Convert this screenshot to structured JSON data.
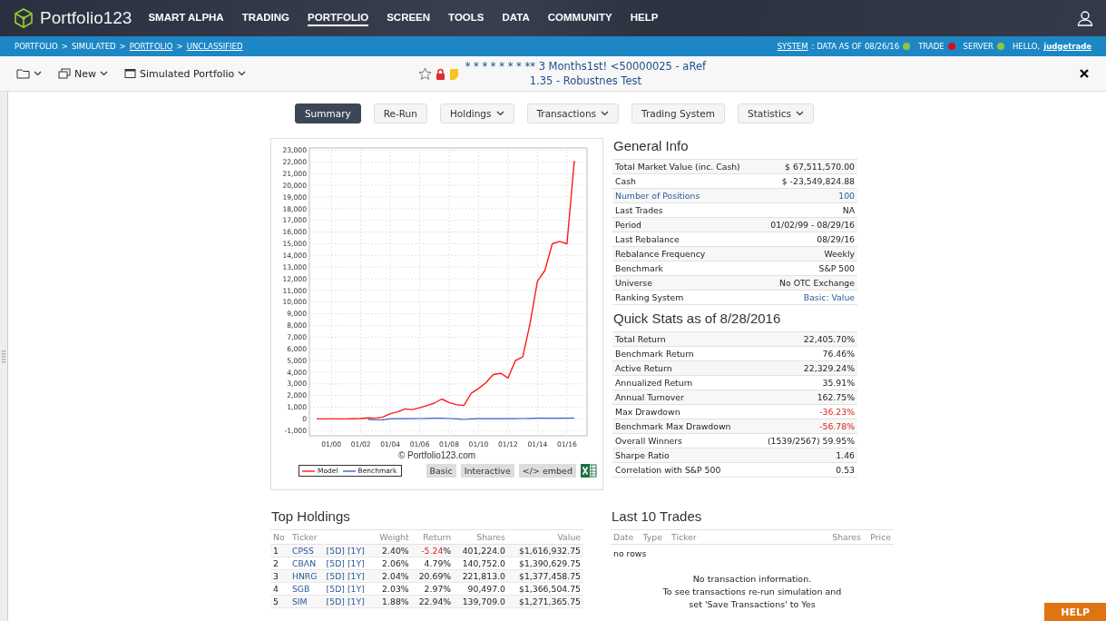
{
  "nav": {
    "brand": "Portfolio123",
    "items": [
      {
        "label": "SMART ALPHA",
        "selected": false
      },
      {
        "label": "TRADING",
        "selected": false
      },
      {
        "label": "PORTFOLIO",
        "selected": true
      },
      {
        "label": "SCREEN",
        "selected": false
      },
      {
        "label": "TOOLS",
        "selected": false
      },
      {
        "label": "DATA",
        "selected": false
      },
      {
        "label": "COMMUNITY",
        "selected": false
      },
      {
        "label": "HELP",
        "selected": false
      }
    ]
  },
  "breadcrumb": {
    "crumbs": [
      {
        "label": "PORTFOLIO",
        "link": false
      },
      {
        "label": "SIMULATED",
        "link": false
      },
      {
        "label": "PORTFOLIO",
        "link": true
      },
      {
        "label": "UNCLASSIFIED",
        "link": true
      }
    ],
    "separators": [
      ">",
      ">",
      ">"
    ],
    "system_link": "SYSTEM",
    "indicators": [
      {
        "label": ": DATA AS OF 08/26/16",
        "color": "#8cc63f"
      },
      {
        "label": "TRADE",
        "color": "#d0101b"
      },
      {
        "label": "SERVER",
        "color": "#8cc63f"
      }
    ],
    "greeting": "HELLO,",
    "user": "judgetrade"
  },
  "toolbar": {
    "new_label": "New",
    "portfolio_type": "Simulated Portfolio",
    "title": "* * * * * * * ** 3 Months1st! <50000025 - aRef 1.35 - Robustnes Test"
  },
  "tabs": [
    {
      "label": "Summary",
      "selected": true,
      "dropdown": false
    },
    {
      "label": "Re-Run",
      "selected": false,
      "dropdown": false
    },
    {
      "label": "Holdings",
      "selected": false,
      "dropdown": true
    },
    {
      "label": "Transactions",
      "selected": false,
      "dropdown": true
    },
    {
      "label": "Trading System",
      "selected": false,
      "dropdown": false
    },
    {
      "label": "Statistics",
      "selected": false,
      "dropdown": true
    }
  ],
  "chart": {
    "copyright": "© Portfolio123.com",
    "buttons": [
      "Basic",
      "Interactive",
      "</> embed"
    ],
    "chart_data": {
      "type": "line",
      "categories": [
        null,
        null,
        "01/00",
        null,
        null,
        null,
        "01/02",
        null,
        null,
        null,
        "01/04",
        null,
        null,
        null,
        "01/06",
        null,
        null,
        null,
        "01/08",
        null,
        null,
        null,
        "01/10",
        null,
        null,
        null,
        "01/12",
        null,
        null,
        null,
        "01/14",
        null,
        null,
        null,
        "01/16",
        null
      ],
      "series": [
        {
          "name": "Model",
          "color": "#ff1a1a",
          "values": [
            0,
            0,
            0,
            0,
            0,
            10,
            30,
            80,
            60,
            150,
            450,
            600,
            850,
            800,
            950,
            1150,
            1350,
            1700,
            1400,
            1200,
            1150,
            2200,
            2600,
            3100,
            3800,
            3900,
            3500,
            5000,
            5300,
            8200,
            11800,
            12700,
            15000,
            15200,
            15000,
            22100
          ]
        },
        {
          "name": "Benchmark",
          "color": "#3a5fd0",
          "values": [
            null,
            null,
            null,
            null,
            null,
            null,
            null,
            -60,
            -90,
            -70,
            0,
            10,
            20,
            20,
            30,
            40,
            50,
            50,
            30,
            0,
            -50,
            0,
            10,
            20,
            20,
            10,
            20,
            20,
            30,
            40,
            50,
            60,
            70,
            60,
            60,
            80
          ]
        }
      ],
      "ylim": [
        -1450,
        23200
      ],
      "grid": true,
      "yticks": [
        {
          "value": -1000,
          "label": "-1,000"
        },
        {
          "value": 0,
          "label": "0"
        },
        {
          "value": 1000,
          "label": "1,000"
        },
        {
          "value": 2000,
          "label": "2,000"
        },
        {
          "value": 3000,
          "label": "3,000"
        },
        {
          "value": 4000,
          "label": "4,000"
        },
        {
          "value": 5000,
          "label": "5,000"
        },
        {
          "value": 6000,
          "label": "6,000"
        },
        {
          "value": 7000,
          "label": "7,000"
        },
        {
          "value": 8000,
          "label": "8,000"
        },
        {
          "value": 9000,
          "label": "9,000"
        },
        {
          "value": 10000,
          "label": "10,000"
        },
        {
          "value": 11000,
          "label": "11,000"
        },
        {
          "value": 12000,
          "label": "12,000"
        },
        {
          "value": 13000,
          "label": "13,000"
        },
        {
          "value": 14000,
          "label": "14,000"
        },
        {
          "value": 15000,
          "label": "15,000"
        },
        {
          "value": 16000,
          "label": "16,000"
        },
        {
          "value": 17000,
          "label": "17,000"
        },
        {
          "value": 18000,
          "label": "18,000"
        },
        {
          "value": 19000,
          "label": "19,000"
        },
        {
          "value": 20000,
          "label": "20,000"
        },
        {
          "value": 21000,
          "label": "21,000"
        },
        {
          "value": 22000,
          "label": "22,000"
        },
        {
          "value": 23000,
          "label": "23,000"
        }
      ]
    }
  },
  "general_info": {
    "title": "General Info",
    "rows": [
      {
        "label": "Total Market Value (inc. Cash)",
        "value": "$ 67,511,570.00",
        "kind": "plain"
      },
      {
        "label": "Cash",
        "value": "$ -23,549,824.88",
        "kind": "plain"
      },
      {
        "label": "Number of Positions",
        "value": "100",
        "kind": "link"
      },
      {
        "label": "Last Trades",
        "value": "NA",
        "kind": "plain"
      },
      {
        "label": "Period",
        "value": "01/02/99 - 08/29/16",
        "kind": "plain"
      },
      {
        "label": "Last Rebalance",
        "value": "08/29/16",
        "kind": "plain"
      },
      {
        "label": "Rebalance Frequency",
        "value": "Weekly",
        "kind": "plain"
      },
      {
        "label": "Benchmark",
        "value": "S&P 500",
        "kind": "plain"
      },
      {
        "label": "Universe",
        "value": "No OTC Exchange",
        "kind": "plain"
      },
      {
        "label": "Ranking System",
        "value": "Basic: Value",
        "kind": "value-link"
      }
    ]
  },
  "quick_stats": {
    "title": "Quick Stats as of 8/28/2016",
    "rows": [
      {
        "label": "Total Return",
        "value": "22,405.70%",
        "kind": "plain"
      },
      {
        "label": "Benchmark Return",
        "value": "76.46%",
        "kind": "plain"
      },
      {
        "label": "Active Return",
        "value": "22,329.24%",
        "kind": "plain"
      },
      {
        "label": "Annualized Return",
        "value": "35.91%",
        "kind": "plain"
      },
      {
        "label": "Annual Turnover",
        "value": "162.75%",
        "kind": "plain"
      },
      {
        "label": "Max Drawdown",
        "value": "-36.23%",
        "kind": "negative"
      },
      {
        "label": "Benchmark Max Drawdown",
        "value": "-56.78%",
        "kind": "negative"
      },
      {
        "label": "Overall Winners",
        "value": "(1539/2567) 59.95%",
        "kind": "plain"
      },
      {
        "label": "Sharpe Ratio",
        "value": "1.46",
        "kind": "plain"
      },
      {
        "label": "Correlation with S&P 500",
        "value": "0.53",
        "kind": "plain"
      }
    ]
  },
  "top_holdings": {
    "title": "Top Holdings",
    "columns": [
      "No",
      "Ticker",
      "Weight",
      "Return",
      "Shares",
      "Value"
    ],
    "rows": [
      {
        "no": "1",
        "ticker": "CPSS",
        "links": [
          "[5D]",
          "[1Y]"
        ],
        "weight": "2.40%",
        "return": {
          "number": "-5.24",
          "unit": "%",
          "negative": true
        },
        "shares": "401,224.0",
        "value": "$1,616,932.75"
      },
      {
        "no": "2",
        "ticker": "CBAN",
        "links": [
          "[5D]",
          "[1Y]"
        ],
        "weight": "2.06%",
        "return": {
          "number": "4.79",
          "unit": "%",
          "negative": false
        },
        "shares": "140,752.0",
        "value": "$1,390,629.75"
      },
      {
        "no": "3",
        "ticker": "HNRG",
        "links": [
          "[5D]",
          "[1Y]"
        ],
        "weight": "2.04%",
        "return": {
          "number": "20.69",
          "unit": "%",
          "negative": false
        },
        "shares": "221,813.0",
        "value": "$1,377,458.75"
      },
      {
        "no": "4",
        "ticker": "SGB",
        "links": [
          "[5D]",
          "[1Y]"
        ],
        "weight": "2.03%",
        "return": {
          "number": "2.97",
          "unit": "%",
          "negative": false
        },
        "shares": "90,497.0",
        "value": "$1,366,504.75"
      },
      {
        "no": "5",
        "ticker": "SIM",
        "links": [
          "[5D]",
          "[1Y]"
        ],
        "weight": "1.88%",
        "return": {
          "number": "22.94",
          "unit": "%",
          "negative": false
        },
        "shares": "139,709.0",
        "value": "$1,271,365.75"
      }
    ]
  },
  "last_trades": {
    "title": "Last 10 Trades",
    "columns": [
      "Date",
      "Type",
      "Ticker",
      "Shares",
      "Price"
    ],
    "empty": "no rows",
    "message_lines": [
      "No transaction information.",
      "To see transactions re-run simulation and",
      "set 'Save Transactions' to Yes"
    ]
  },
  "help_button": "HELP"
}
